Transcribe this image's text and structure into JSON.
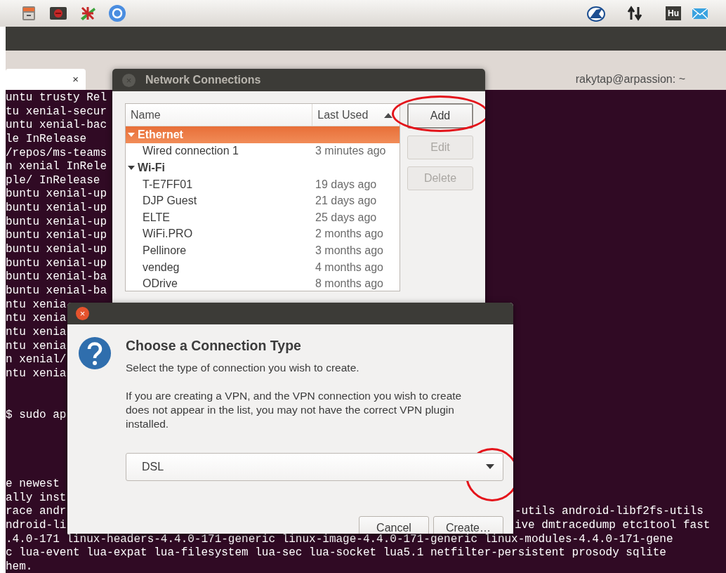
{
  "top_panel": {
    "keyboard_layout": "Hu"
  },
  "terminal": {
    "tab_close": "×",
    "title": "rakytap@arpassion: ~",
    "lines": [
      {
        "kind": "text",
        "text": "untu trusty Rel"
      },
      {
        "kind": "text",
        "text": "tu xenial-secur"
      },
      {
        "kind": "text",
        "text": "untu xenial-bac"
      },
      {
        "kind": "text",
        "text": "le InRelease"
      },
      {
        "kind": "text",
        "text": "/repos/ms-teams"
      },
      {
        "kind": "text",
        "text": "n xenial InRele"
      },
      {
        "kind": "text",
        "text": "ple/ InRelease"
      },
      {
        "kind": "text",
        "text": "buntu xenial-up"
      },
      {
        "kind": "text",
        "text": "buntu xenial-up"
      },
      {
        "kind": "text",
        "text": "buntu xenial-up"
      },
      {
        "kind": "text",
        "text": "buntu xenial-up"
      },
      {
        "kind": "text",
        "text": "buntu xenial-up"
      },
      {
        "kind": "text",
        "text": "buntu xenial-up"
      },
      {
        "kind": "text",
        "text": "buntu xenial-ba"
      },
      {
        "kind": "text",
        "text": "buntu xenial-ba"
      },
      {
        "kind": "text",
        "text": "ntu xenia"
      },
      {
        "kind": "text",
        "text": "ntu xenia"
      },
      {
        "kind": "text",
        "text": "ntu xenia"
      },
      {
        "kind": "text",
        "text": "ntu xenia"
      },
      {
        "kind": "text",
        "text": "n xenial/"
      },
      {
        "kind": "text",
        "text": "ntu xenia"
      },
      {
        "kind": "blank"
      },
      {
        "kind": "blank"
      },
      {
        "kind": "text",
        "text": "$ sudo ap"
      },
      {
        "kind": "blank"
      },
      {
        "kind": "blank"
      },
      {
        "kind": "blank"
      },
      {
        "kind": "blank"
      },
      {
        "kind": "text",
        "text": "e newest"
      },
      {
        "kind": "text",
        "text": "ally inst"
      },
      {
        "kind": "split",
        "text": "race andr",
        "tail": "-utils android-libf2fs-utils"
      },
      {
        "kind": "split",
        "text": "ndroid-li",
        "tail": "ive dmtracedump etc1tool fast"
      },
      {
        "kind": "text",
        "text": ".4.0-171 linux-headers-4.4.0-171-generic linux-image-4.4.0-171-generic linux-modules-4.4.0-171-gene"
      },
      {
        "kind": "text",
        "text": "c lua-event lua-expat lua-filesystem lua-sec lua-socket lua5.1 netfilter-persistent prosody sqlite"
      },
      {
        "kind": "text",
        "text": "hem."
      }
    ]
  },
  "network_connections": {
    "close_glyph": "×",
    "title": "Network Connections",
    "columns": [
      {
        "label": "Name",
        "sorted": false
      },
      {
        "label": "Last Used",
        "sorted": true
      }
    ],
    "groups": [
      {
        "label": "Ethernet",
        "expanded": true,
        "selected": true,
        "children": [
          {
            "name": "Wired connection 1",
            "last_used": "3 minutes ago",
            "selected": false
          }
        ]
      },
      {
        "label": "Wi-Fi",
        "expanded": true,
        "selected": false,
        "children": [
          {
            "name": "T-E7FF01",
            "last_used": "19 days ago",
            "selected": false
          },
          {
            "name": "DJP Guest",
            "last_used": "21 days ago",
            "selected": false
          },
          {
            "name": "ELTE",
            "last_used": "25 days ago",
            "selected": false
          },
          {
            "name": "WiFi.PRO",
            "last_used": "2 months ago",
            "selected": false
          },
          {
            "name": "Pellinore",
            "last_used": "3 months ago",
            "selected": false
          },
          {
            "name": "vendeg",
            "last_used": "4 months ago",
            "selected": false
          },
          {
            "name": "ODrive",
            "last_used": "8 months ago",
            "selected": false
          }
        ]
      }
    ],
    "buttons": [
      {
        "label": "Add",
        "disabled": false,
        "focused": true,
        "circled": true
      },
      {
        "label": "Edit",
        "disabled": true,
        "focused": false,
        "circled": false
      },
      {
        "label": "Delete",
        "disabled": true,
        "focused": false,
        "circled": false
      }
    ]
  },
  "connection_type_dialog": {
    "close_glyph": "×",
    "heading": "Choose a Connection Type",
    "subtitle": "Select the type of connection you wish to create.",
    "note": "If you are creating a VPN, and the VPN connection you wish to create does not appear in the list, you may not have the correct VPN plugin installed.",
    "type_select": {
      "value": "DSL",
      "circled": true
    },
    "buttons": [
      {
        "label": "Cancel"
      },
      {
        "label": "Create…"
      }
    ]
  }
}
